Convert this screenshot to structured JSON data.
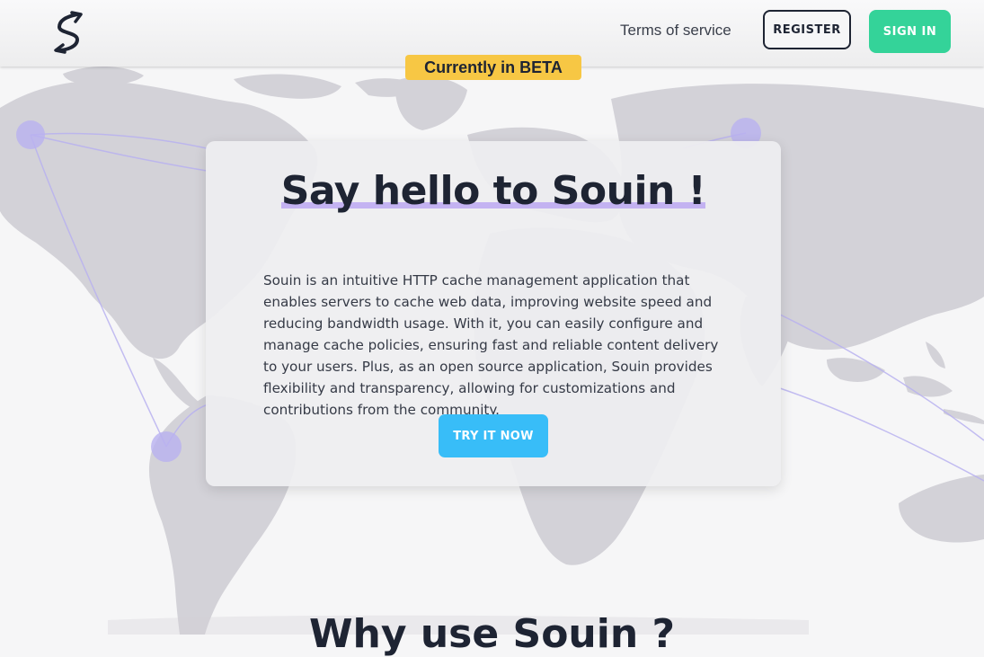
{
  "header": {
    "logo_letter": "S",
    "nav": {
      "terms_label": "Terms of service"
    },
    "register_label": "REGISTER",
    "signin_label": "SIGN IN"
  },
  "beta_badge": "Currently in BETA",
  "hero": {
    "title": "Say hello to Souin !",
    "description": "Souin is an intuitive HTTP cache management application that enables servers to cache web data, improving website speed and reducing bandwidth usage. With it, you can easily configure and manage cache policies, ensuring fast and reliable content delivery to your users. Plus, as an open source application, Souin provides flexibility and transparency, allowing for customizations and contributions from the community.",
    "cta_label": "TRY IT NOW"
  },
  "next_section": {
    "title_partial": "Why use Souin ?"
  },
  "icons": {
    "logo": "souin-logo-icon",
    "map": "world-map-illustration"
  },
  "colors": {
    "accent_green": "#34d399",
    "accent_blue": "#38bdf8",
    "beta_yellow": "#f7c744",
    "underline_purple": "#b69ff2",
    "text_dark": "#1e2433",
    "map_gray": "#d2d1d7"
  }
}
